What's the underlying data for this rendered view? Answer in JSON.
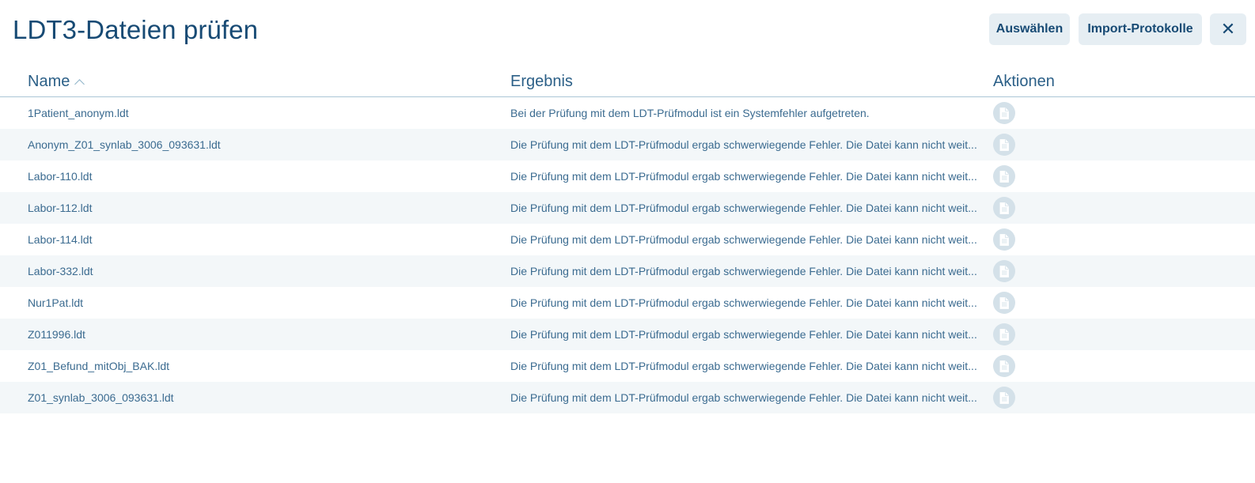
{
  "header": {
    "title": "LDT3-Dateien prüfen",
    "select_label": "Auswählen",
    "import_label": "Import-Protokolle",
    "close_glyph": "✕"
  },
  "table": {
    "columns": {
      "name": "Name",
      "result": "Ergebnis",
      "actions": "Aktionen"
    },
    "sort": "name-ascending",
    "rows": [
      {
        "name": "1Patient_anonym.ldt",
        "result": "Bei der Prüfung mit dem LDT-Prüfmodul ist ein Systemfehler aufgetreten."
      },
      {
        "name": "Anonym_Z01_synlab_3006_093631.ldt",
        "result": "Die Prüfung mit dem LDT-Prüfmodul ergab schwerwiegende Fehler. Die Datei kann nicht weit..."
      },
      {
        "name": "Labor-110.ldt",
        "result": "Die Prüfung mit dem LDT-Prüfmodul ergab schwerwiegende Fehler. Die Datei kann nicht weit..."
      },
      {
        "name": "Labor-112.ldt",
        "result": "Die Prüfung mit dem LDT-Prüfmodul ergab schwerwiegende Fehler. Die Datei kann nicht weit..."
      },
      {
        "name": "Labor-114.ldt",
        "result": "Die Prüfung mit dem LDT-Prüfmodul ergab schwerwiegende Fehler. Die Datei kann nicht weit..."
      },
      {
        "name": "Labor-332.ldt",
        "result": "Die Prüfung mit dem LDT-Prüfmodul ergab schwerwiegende Fehler. Die Datei kann nicht weit..."
      },
      {
        "name": "Nur1Pat.ldt",
        "result": "Die Prüfung mit dem LDT-Prüfmodul ergab schwerwiegende Fehler. Die Datei kann nicht weit..."
      },
      {
        "name": "Z011996.ldt",
        "result": "Die Prüfung mit dem LDT-Prüfmodul ergab schwerwiegende Fehler. Die Datei kann nicht weit..."
      },
      {
        "name": "Z01_Befund_mitObj_BAK.ldt",
        "result": "Die Prüfung mit dem LDT-Prüfmodul ergab schwerwiegende Fehler. Die Datei kann nicht weit..."
      },
      {
        "name": "Z01_synlab_3006_093631.ldt",
        "result": "Die Prüfung mit dem LDT-Prüfmodul ergab schwerwiegende Fehler. Die Datei kann nicht weit..."
      }
    ],
    "action_icon": "document-icon"
  },
  "colors": {
    "primary_text": "#174a74",
    "button_bg": "#e6eef3",
    "row_alt_bg": "#f3f7f9",
    "icon_bg": "#d4e1e9"
  }
}
